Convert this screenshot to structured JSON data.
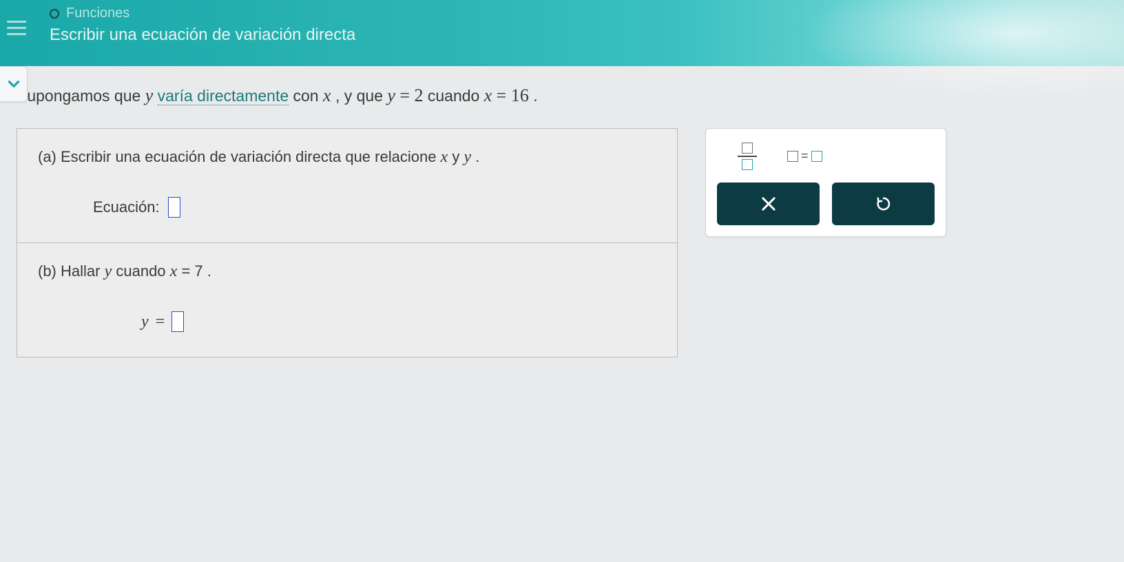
{
  "header": {
    "category": "Funciones",
    "topic": "Escribir una ecuación de variación directa"
  },
  "problem": {
    "prefix": "Supongamos que ",
    "var_y": "y",
    "link_text": "varía directamente",
    "mid1": " con ",
    "var_x": "x",
    "mid2": ", y que ",
    "eq1_lhs": "y",
    "eq1_eq": " = ",
    "eq1_rhs": "2",
    "mid3": " cuando ",
    "eq2_lhs": "x",
    "eq2_eq": " = ",
    "eq2_rhs": "16",
    "end": "."
  },
  "parts": {
    "a": {
      "label": "(a) Escribir una ecuación de variación directa que relacione ",
      "var1": "x",
      "sep": "  y  ",
      "var2": "y",
      "end": " .",
      "equation_label": "Ecuación:"
    },
    "b": {
      "label": "(b) Hallar ",
      "var_y": "y",
      "mid": "  cuando  ",
      "var_x": "x",
      "eq": " = ",
      "val": "7",
      "end": " .",
      "answer_lhs": "y",
      "answer_eq": " = "
    }
  },
  "tools": {
    "fraction": "fraction",
    "equation": "=",
    "clear": "clear",
    "reset": "reset"
  }
}
